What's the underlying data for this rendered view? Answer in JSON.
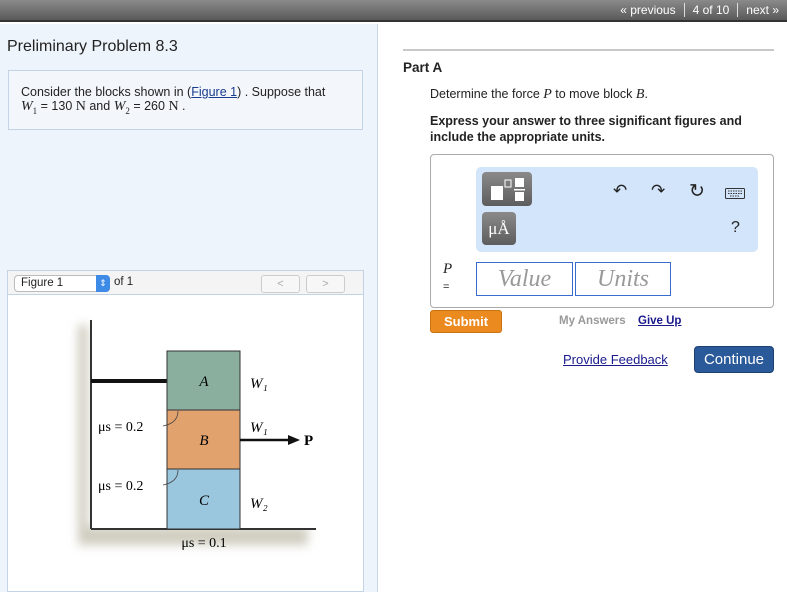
{
  "nav": {
    "previous": "« previous",
    "position": "4 of 10",
    "next": "next »"
  },
  "problem": {
    "title": "Preliminary Problem 8.3",
    "text_a": "Consider the blocks shown in (",
    "figure_link": "Figure 1",
    "text_b": ") . Suppose that",
    "w1": "W",
    "w1_sub": "1",
    "w1_val": " = 130 ",
    "unit1": "N",
    "and": " and ",
    "w2": "W",
    "w2_sub": "2",
    "w2_val": " = 260 ",
    "unit2": "N",
    "end": " ."
  },
  "figure": {
    "select": "Figure 1",
    "of": "of 1",
    "prev": "<",
    "next": ">",
    "labels": {
      "A": "A",
      "B": "B",
      "C": "C",
      "W1a": "W₁",
      "W1b": "W₁",
      "W2": "W₂",
      "P": "P",
      "mu1": "μs = 0.2",
      "mu2": "μs = 0.2",
      "mu3": "μs = 0.1"
    }
  },
  "part": {
    "title": "Part A",
    "q_a": "Determine the force ",
    "q_P": "P",
    "q_b": " to move block ",
    "q_B": "B",
    "q_c": ".",
    "instructions": "Express your answer to three significant figures and include the appropriate units."
  },
  "answer": {
    "var": "P",
    "eq": "=",
    "value_placeholder": "Value",
    "units_placeholder": "Units",
    "units_btn": "μÅ",
    "help": "?"
  },
  "actions": {
    "submit": "Submit",
    "my_answers": "My Answers",
    "give_up": "Give Up",
    "feedback": "Provide Feedback",
    "continue": "Continue"
  }
}
